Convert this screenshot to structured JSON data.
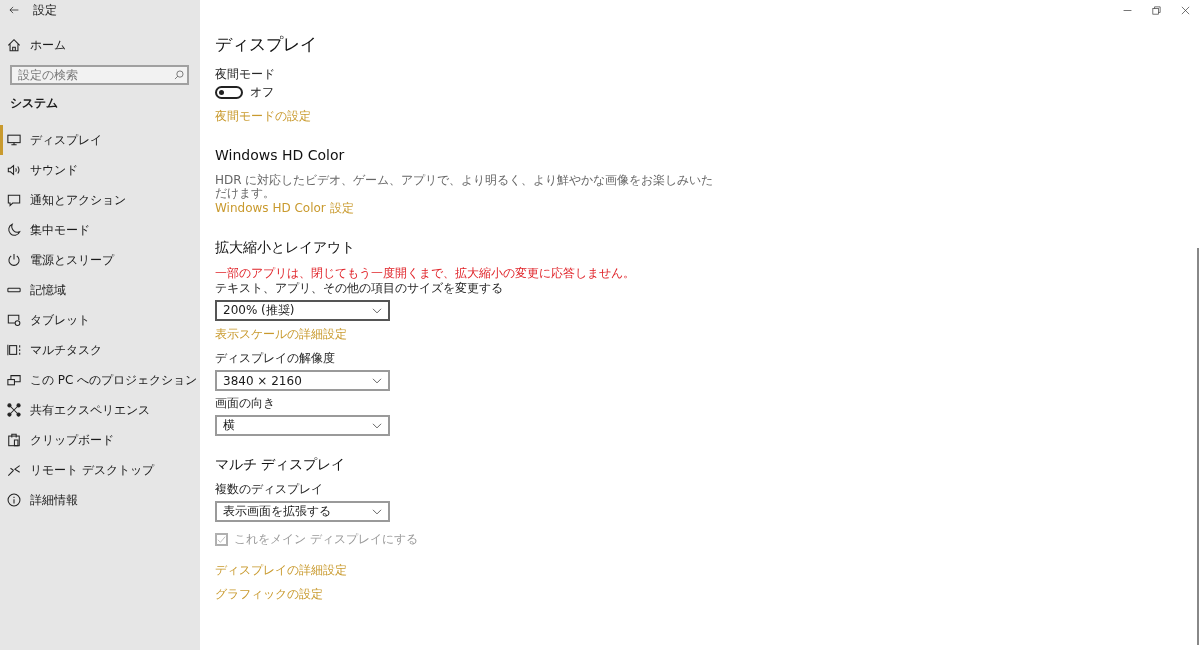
{
  "window": {
    "title": "設定"
  },
  "sidebar": {
    "home": "ホーム",
    "search": {
      "placeholder": "設定の検索"
    },
    "section": "システム",
    "items": [
      {
        "label": "ディスプレイ",
        "selected": true
      },
      {
        "label": "サウンド",
        "selected": false
      },
      {
        "label": "通知とアクション",
        "selected": false
      },
      {
        "label": "集中モード",
        "selected": false
      },
      {
        "label": "電源とスリープ",
        "selected": false
      },
      {
        "label": "記憶域",
        "selected": false
      },
      {
        "label": "タブレット",
        "selected": false
      },
      {
        "label": "マルチタスク",
        "selected": false
      },
      {
        "label": "この PC へのプロジェクション",
        "selected": false
      },
      {
        "label": "共有エクスペリエンス",
        "selected": false
      },
      {
        "label": "クリップボード",
        "selected": false
      },
      {
        "label": "リモート デスクトップ",
        "selected": false
      },
      {
        "label": "詳細情報",
        "selected": false
      }
    ]
  },
  "content": {
    "title": "ディスプレイ",
    "blocks": [
      {
        "kind": "label",
        "text": "夜間モード"
      },
      {
        "kind": "toggle",
        "on": false,
        "text": "オフ"
      },
      {
        "kind": "link",
        "text": "夜間モードの設定"
      },
      {
        "kind": "heading",
        "text": "Windows HD Color"
      },
      {
        "kind": "description",
        "text": "HDR に対応したビデオ、ゲーム、アプリで、より明るく、より鮮やかな画像をお楽しみいただけます。"
      },
      {
        "kind": "link",
        "text": "Windows HD Color 設定"
      },
      {
        "kind": "heading",
        "text": "拡大縮小とレイアウト"
      },
      {
        "kind": "warning",
        "text": "一部のアプリは、閉じてもう一度開くまで、拡大縮小の変更に応答しません。"
      },
      {
        "kind": "label",
        "text": "テキスト、アプリ、その他の項目のサイズを変更する"
      },
      {
        "kind": "dropdown",
        "value": "200% (推奨)",
        "focused": true
      },
      {
        "kind": "link",
        "text": "表示スケールの詳細設定"
      },
      {
        "kind": "label",
        "text": "ディスプレイの解像度"
      },
      {
        "kind": "dropdown",
        "value": "3840 × 2160",
        "focused": false
      },
      {
        "kind": "label",
        "text": "画面の向き"
      },
      {
        "kind": "dropdown",
        "value": "横",
        "focused": false
      },
      {
        "kind": "heading",
        "text": "マルチ ディスプレイ"
      },
      {
        "kind": "label",
        "text": "複数のディスプレイ"
      },
      {
        "kind": "dropdown",
        "value": "表示画面を拡張する",
        "focused": false
      },
      {
        "kind": "checkbox",
        "text": "これをメイン ディスプレイにする",
        "checked": true,
        "disabled": true
      },
      {
        "kind": "link",
        "text": "ディスプレイの詳細設定"
      },
      {
        "kind": "link",
        "text": "グラフィックの設定"
      }
    ]
  }
}
